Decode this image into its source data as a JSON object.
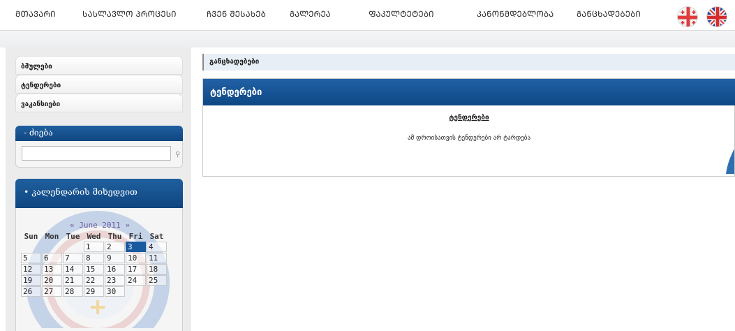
{
  "nav": {
    "items": [
      "ᲛᲗᲐᲕᲐᲠᲘ",
      "ᲡᲐᲡᲚᲐᲕᲚᲝ ᲞᲠᲝᲪᲔᲡᲘ",
      "ᲩᲕᲔᲜ ᲨᲔᲡᲐᲮᲔᲑ",
      "ᲒᲐᲚᲔᲠᲔᲐ",
      "ᲤᲐᲙᲣᲚᲢᲔᲢᲔᲑᲘ",
      "ᲙᲐᲜᲝᲜᲛᲓᲔᲑᲚᲝᲑᲐ",
      "ᲒᲐᲜᲪᲮᲐᲓᲔᲑᲔᲑᲘ"
    ],
    "flags": [
      "georgia-flag-icon",
      "uk-flag-icon"
    ]
  },
  "sidebar": {
    "links": [
      "ბმულები",
      "ტენდერები",
      "ვაკანსიები"
    ],
    "search": {
      "title": "- ძიება",
      "value": "",
      "placeholder": "",
      "icon": "search-icon"
    },
    "calendar": {
      "title": "• კალენდარის მიხედვით",
      "month_label": "« June 2011 »",
      "weekdays": [
        "Sun",
        "Mon",
        "Tue",
        "Wed",
        "Thu",
        "Fri",
        "Sat"
      ],
      "weeks": [
        [
          "",
          "",
          "",
          "1",
          "2",
          "3",
          "4"
        ],
        [
          "5",
          "6",
          "7",
          "8",
          "9",
          "10",
          "11"
        ],
        [
          "12",
          "13",
          "14",
          "15",
          "16",
          "17",
          "18"
        ],
        [
          "19",
          "20",
          "21",
          "22",
          "23",
          "24",
          "25"
        ],
        [
          "26",
          "27",
          "28",
          "29",
          "30",
          "",
          ""
        ]
      ],
      "today": "3"
    }
  },
  "main": {
    "breadcrumb": "განცხადებები",
    "panel_title": "ტენდერები",
    "panel_subtitle": "ტენდერები",
    "panel_text": "ამ დროისათვის ტენდერები არ ტარდება"
  },
  "colors": {
    "header_blue": "#0f4680",
    "today_blue": "#1a5aa0",
    "breadcrumb_bg": "#e7eef5"
  }
}
